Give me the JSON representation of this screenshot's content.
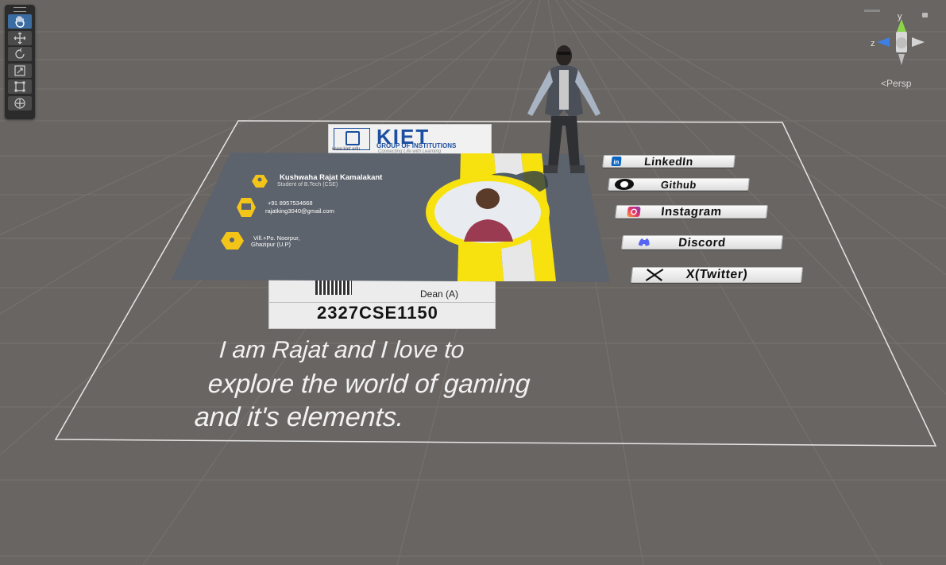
{
  "toolbar": {
    "tools": [
      {
        "name": "hand-tool",
        "active": true
      },
      {
        "name": "move-tool",
        "active": false
      },
      {
        "name": "rotate-tool",
        "active": false
      },
      {
        "name": "scale-tool",
        "active": false
      },
      {
        "name": "rect-tool",
        "active": false
      },
      {
        "name": "transform-tool",
        "active": false
      }
    ]
  },
  "gizmo": {
    "y_label": "y",
    "z_label": "z",
    "projection_label": "Persp"
  },
  "kiet_logo": {
    "name": "KIET",
    "subtitle": "GROUP OF INSTITUTIONS",
    "tagline": "Connecting Life with Learning",
    "url": "www.kiet.edu"
  },
  "business_card": {
    "name": "Kushwaha Rajat Kamalakant",
    "role": "Student of B.Tech (CSE)",
    "phone": "+91 8957534668",
    "email": "rajatking3040@gmail.com",
    "address_line1": "Vill.+Po. Noorpur,",
    "address_line2": "Ghazipur (U.P)"
  },
  "id_card": {
    "designation": "Dean (A)",
    "roll_number": "2327CSE1150"
  },
  "social_links": [
    {
      "label": "LinkedIn",
      "icon": "linkedin-icon"
    },
    {
      "label": "Github",
      "icon": "github-icon"
    },
    {
      "label": "Instagram",
      "icon": "instagram-icon"
    },
    {
      "label": "Discord",
      "icon": "discord-icon"
    },
    {
      "label": "X(Twitter)",
      "icon": "x-icon"
    }
  ],
  "bio": {
    "line1": "I am Rajat and I love to",
    "line2": "explore the world of gaming",
    "line3": "and it's elements."
  },
  "colors": {
    "accent_yellow": "#f7e20f",
    "card_gray": "#5d636c",
    "kiet_blue": "#1c4fa0",
    "viewport_bg": "#696562"
  }
}
